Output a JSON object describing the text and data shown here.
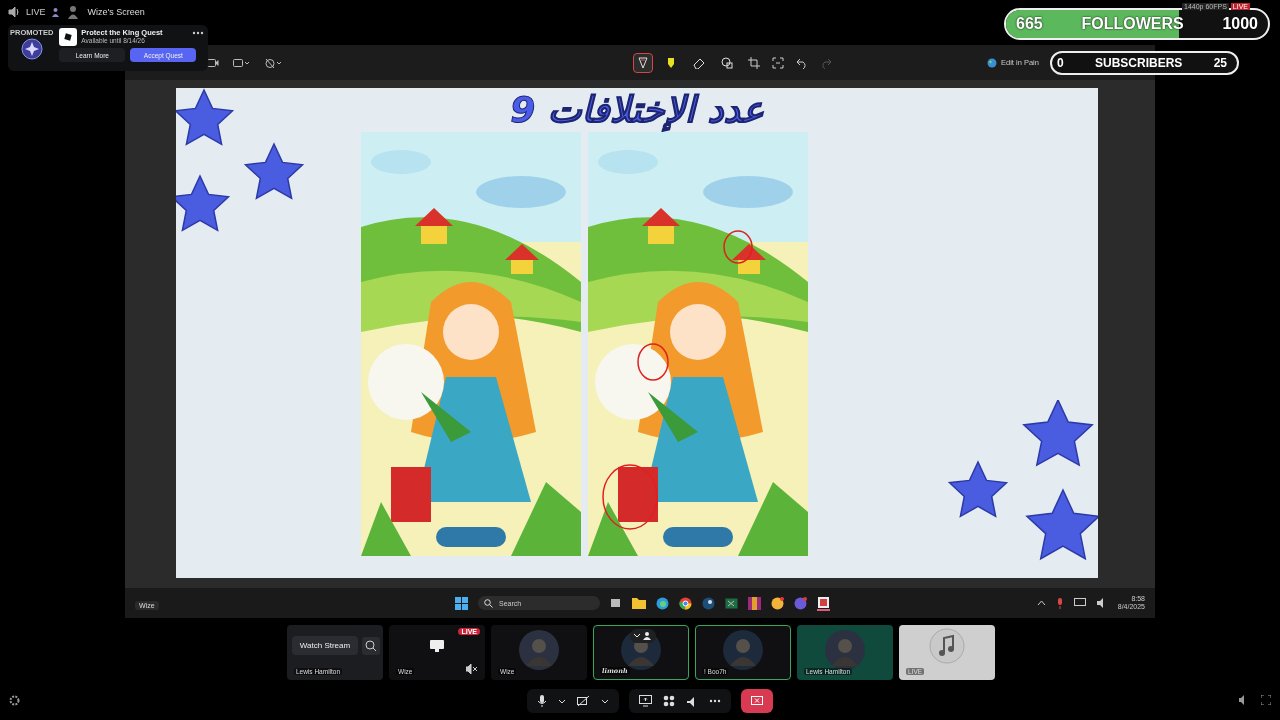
{
  "header": {
    "live_label": "LIVE",
    "screen_title": "Wize's Screen"
  },
  "promo": {
    "badge": "PROMOTED",
    "title": "Protect the King Quest",
    "subtitle": "Available until 8/14/26",
    "buttons": [
      {
        "label": "Learn More",
        "primary": false
      },
      {
        "label": "Accept Quest",
        "primary": true
      }
    ]
  },
  "overlay": {
    "followers": {
      "count": "665",
      "label": "FOLLOWERS",
      "goal": "1000",
      "level": 0.66,
      "quality": "1440p 60FPS",
      "live": "LIVE"
    },
    "subscribers": {
      "count": "0",
      "label": "SUBSCRIBERS",
      "goal": "25",
      "level": 0
    }
  },
  "editor": {
    "tools": [
      {
        "kind": "pen",
        "selected": true
      },
      {
        "kind": "highlighter",
        "selected": false
      },
      {
        "kind": "eraser",
        "selected": false
      },
      {
        "kind": "shapes",
        "selected": false
      }
    ],
    "edit_label": "Edit in Pain"
  },
  "canvas": {
    "title": "عدد الإختلافات 9",
    "panels": [
      {
        "kind": "picture",
        "annotated": false
      },
      {
        "kind": "picture",
        "annotated": true
      }
    ]
  },
  "taskbar": {
    "user_label": "Wize",
    "search_placeholder": "Search",
    "time": "8:58",
    "date": "8/4/2025"
  },
  "tiles": [
    {
      "kind": "stream",
      "name": "Lewis Hamilton",
      "button": "Watch Stream",
      "speaking": false
    },
    {
      "kind": "screen",
      "name": "Wize",
      "badge": "LIVE",
      "speaking": false
    },
    {
      "kind": "avatar",
      "name": "Wize",
      "speaking": false
    },
    {
      "kind": "user",
      "name": "limonh",
      "speaking": true
    },
    {
      "kind": "avatar",
      "name": "! Boo7h",
      "speaking": true
    },
    {
      "kind": "avatar",
      "name": "Lewis Hamilton",
      "speaking": false
    },
    {
      "kind": "music",
      "name": "LIVE",
      "speaking": false
    }
  ]
}
